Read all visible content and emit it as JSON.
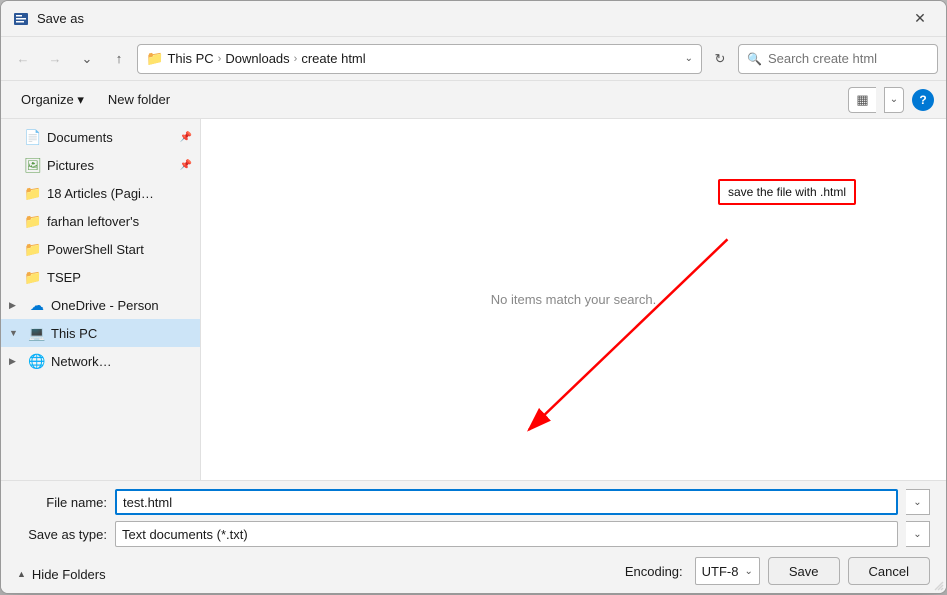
{
  "titleBar": {
    "title": "Save as",
    "closeLabel": "✕"
  },
  "addressBar": {
    "path": [
      "This PC",
      "Downloads",
      "create html"
    ],
    "searchPlaceholder": "Search create html",
    "refreshIcon": "↻",
    "chevronIcon": "∨"
  },
  "navButtons": {
    "backDisabled": true,
    "forwardDisabled": true,
    "upIcon": "↑"
  },
  "toolbar": {
    "organizeLabel": "Organize ▾",
    "newFolderLabel": "New folder",
    "viewIcon": "▦",
    "helpLabel": "?"
  },
  "sidebar": {
    "items": [
      {
        "id": "documents",
        "label": "Documents",
        "icon": "📄",
        "type": "pinned",
        "indent": 1
      },
      {
        "id": "pictures",
        "label": "Pictures",
        "icon": "🖼",
        "type": "pinned",
        "indent": 1
      },
      {
        "id": "18articles",
        "label": "18 Articles (Pagi…",
        "icon": "📁",
        "type": "folder",
        "indent": 1
      },
      {
        "id": "farhan",
        "label": "farhan leftover's",
        "icon": "📁",
        "type": "folder",
        "indent": 1
      },
      {
        "id": "powershell",
        "label": "PowerShell Start",
        "icon": "📁",
        "type": "folder",
        "indent": 1
      },
      {
        "id": "tsep",
        "label": "TSEP",
        "icon": "📁",
        "type": "folder",
        "indent": 1
      },
      {
        "id": "onedrive",
        "label": "OneDrive - Person",
        "icon": "☁",
        "type": "tree",
        "expanded": false
      },
      {
        "id": "thispc",
        "label": "This PC",
        "icon": "💻",
        "type": "tree",
        "expanded": true,
        "selected": true
      },
      {
        "id": "network",
        "label": "Network…",
        "icon": "🌐",
        "type": "tree",
        "expanded": false
      }
    ]
  },
  "mainPanel": {
    "noItemsText": "No items match your search."
  },
  "annotation": {
    "text": "save the file with .html"
  },
  "bottomArea": {
    "fileNameLabel": "File name:",
    "fileNameValue": "test.html",
    "saveTypeLabel": "Save as type:",
    "saveTypeValue": "Text documents (*.txt)",
    "encodingLabel": "Encoding:",
    "encodingValue": "UTF-8",
    "saveLabel": "Save",
    "cancelLabel": "Cancel",
    "hideFoldersLabel": "Hide Folders",
    "hideFoldersChevron": "▲"
  }
}
